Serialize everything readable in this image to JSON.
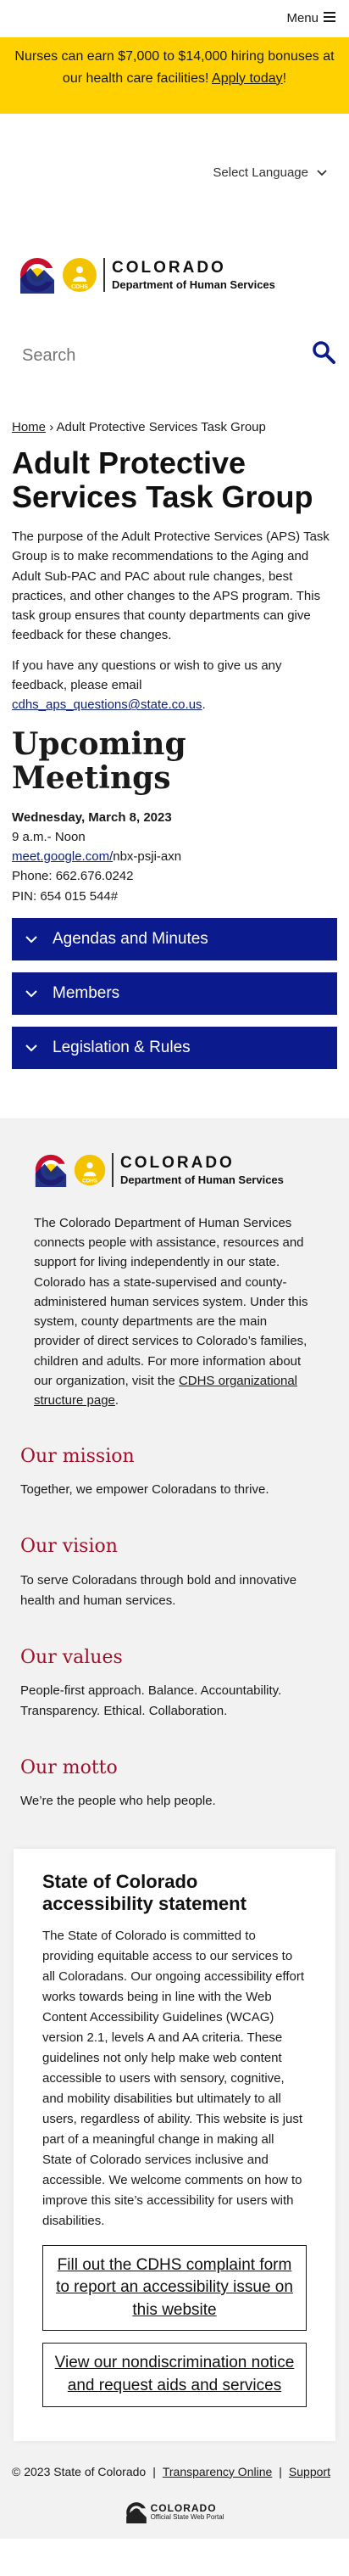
{
  "topbar": {
    "menu_label": "Menu",
    "menu_icon": "hamburger-icon"
  },
  "alert": {
    "text": "Nurses can earn $7,000 to $14,000 hiring bonuses at our health care facilities! ",
    "link": "Apply today",
    "suffix": "!"
  },
  "language": {
    "label": "Select Language"
  },
  "brand": {
    "state": "COLORADO",
    "dept": "Department of Human Services",
    "badge": "CDHS"
  },
  "search": {
    "placeholder": "Search",
    "icon": "search-icon"
  },
  "breadcrumb": {
    "home": "Home",
    "separator": "›",
    "current": "Adult Protective Services Task Group"
  },
  "page": {
    "title": "Adult Protective Services Task Group",
    "intro": "The purpose of the Adult Protective Services (APS) Task Group is to make recommendations to the Aging and Adult Sub-PAC and PAC about rule changes, best practices, and other changes to the APS program. This task group ensures that county departments can give feedback for these changes.",
    "contact_text": "If you have any questions or wish to give us any feedback, please email",
    "contact_email": "cdhs_aps_questions@state.co.us",
    "contact_suffix": "."
  },
  "meetings": {
    "heading": "Upcoming Meetings",
    "date": "Wednesday, March 8, 2023",
    "time": "9 a.m.- Noon",
    "link": "meet.google.com/",
    "link_suffix": "nbx-psji-axn",
    "phone": "Phone: 662.676.0242",
    "pin": "PIN: 654 015 544#"
  },
  "accordions": [
    {
      "label": "Agendas and Minutes"
    },
    {
      "label": "Members"
    },
    {
      "label": "Legislation & Rules"
    }
  ],
  "footer": {
    "about": "The Colorado Department of Human Services connects people with assistance, resources and support for living independently in our state. Colorado has a state-supervised and county-administered human services system. Under this system, county departments are the main provider of direct services to Colorado’s families, children and adults. For more information about our organization, visit the ",
    "about_link": "CDHS organizational structure page",
    "about_suffix": ".",
    "mission_title": "Our mission",
    "mission": "Together, we empower Coloradans to thrive.",
    "vision_title": "Our vision",
    "vision": "To serve Coloradans through bold and innovative health and human services.",
    "values_title": "Our values",
    "values": "People-first approach. Balance. Accountability. Transparency. Ethical. Collaboration.",
    "motto_title": "Our motto",
    "motto": "We’re the people who help people."
  },
  "accessibility": {
    "title": "State of Colorado accessibility statement",
    "body": "The State of Colorado is committed to providing equitable access to our services to all Coloradans. Our ongoing accessibility effort works towards being in line with the Web Content Accessibility Guidelines (WCAG) version 2.1, levels A and AA criteria. These guidelines not only help make web content accessible to users with sensory, cognitive, and mobility disabilities but ultimately to all users, regardless of ability. This website is just part of a meaningful change in making all State of Colorado services inclusive and accessible. We welcome comments on how to improve this site’s accessibility for users with disabilities.",
    "cta1": "Fill out the CDHS complaint form to report an accessibility issue on this website",
    "cta2": "View our nondiscrimination notice and request aids and services"
  },
  "bottom": {
    "copyright": "© 2023 State of Colorado",
    "sep": "|",
    "transparency": "Transparency Online",
    "support": "Support",
    "portal_name": "COLORADO",
    "portal_sub": "Official State Web Portal"
  },
  "colors": {
    "alert": "#ffd100",
    "accordion": "#0b1a8c",
    "section_heading": "#a30f2a",
    "footer_bg": "#f2f2f2"
  }
}
